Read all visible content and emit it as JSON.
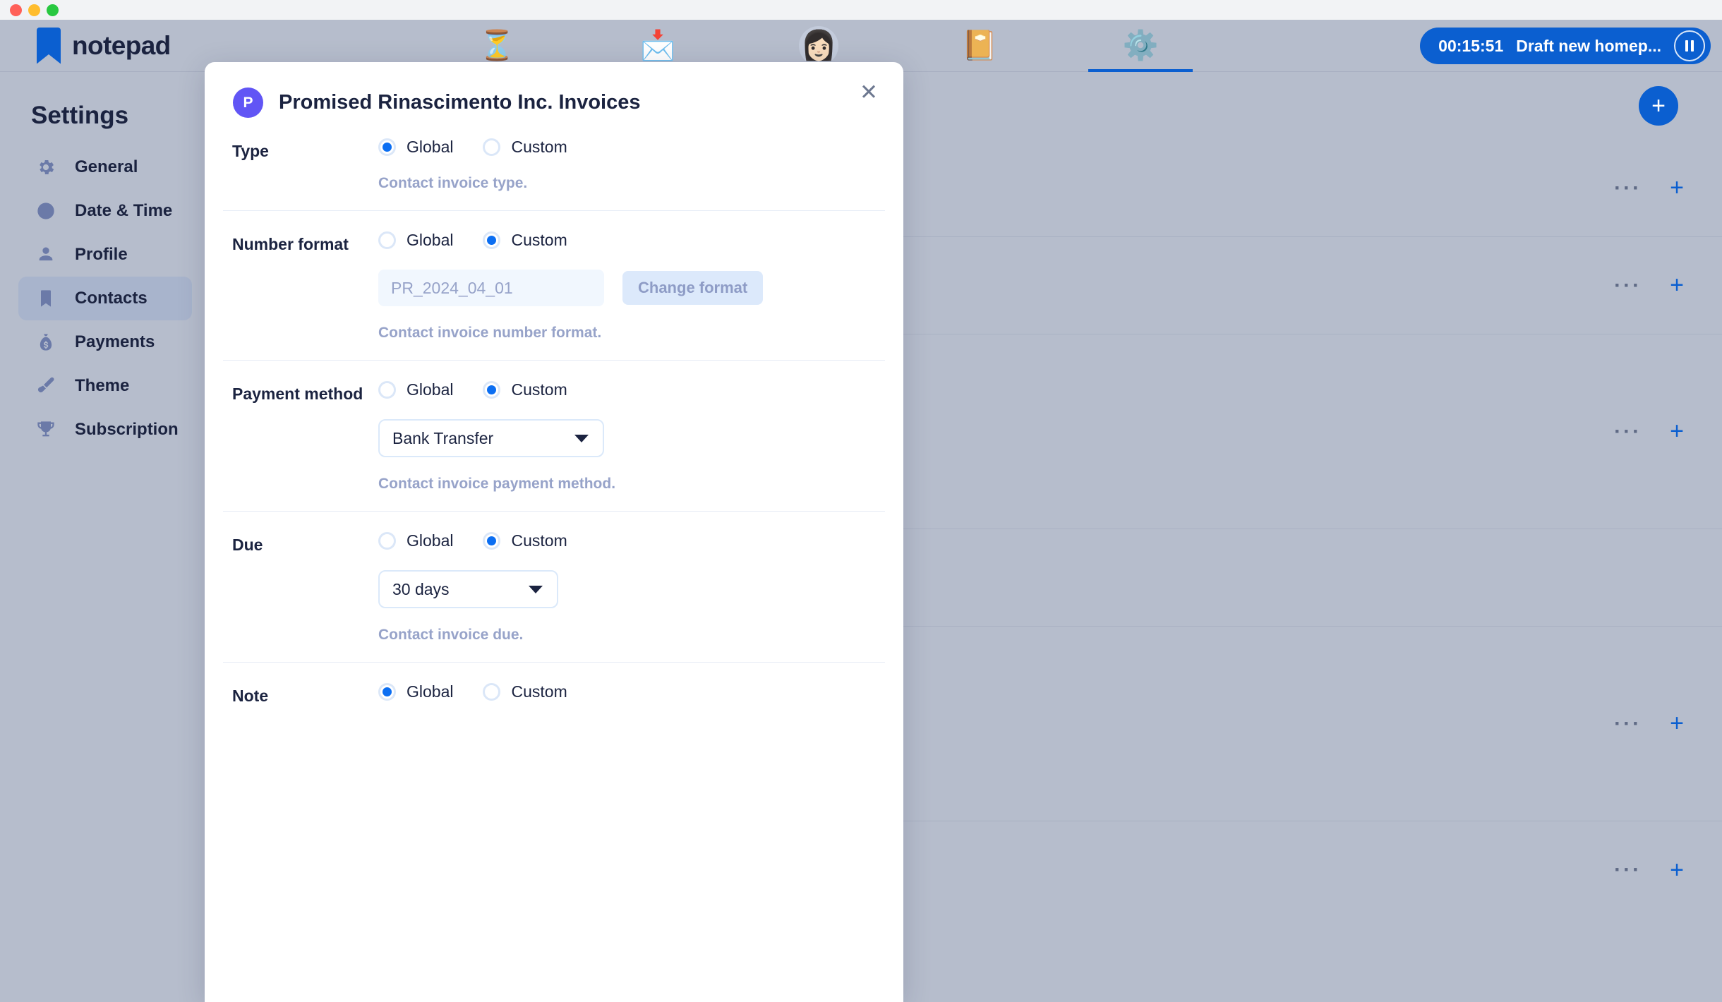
{
  "window": {
    "traffic_lights": [
      "close",
      "minimize",
      "maximize"
    ]
  },
  "topbar": {
    "brand": "notepad",
    "brand_logo_icon": "bookmark-icon",
    "nav": [
      {
        "name": "hourglass",
        "glyph": "⏳",
        "active": false
      },
      {
        "name": "envelope",
        "glyph": "📩",
        "active": false
      },
      {
        "name": "profile-avatar",
        "glyph": "👩🏻",
        "active": false
      },
      {
        "name": "notebook",
        "glyph": "📔",
        "active": false
      },
      {
        "name": "settings-gear",
        "glyph": "⚙️",
        "active": true
      }
    ],
    "timer": {
      "time": "00:15:51",
      "task": "Draft new homep...",
      "pause_icon": "pause-icon"
    }
  },
  "sidebar": {
    "title": "Settings",
    "items": [
      {
        "label": "General",
        "icon": "gear-icon",
        "active": false
      },
      {
        "label": "Date & Time",
        "icon": "clock-icon",
        "active": false
      },
      {
        "label": "Profile",
        "icon": "person-icon",
        "active": false
      },
      {
        "label": "Contacts",
        "icon": "bookmark-icon",
        "active": true
      },
      {
        "label": "Payments",
        "icon": "money-bag-icon",
        "active": false
      },
      {
        "label": "Theme",
        "icon": "paintbrush-icon",
        "active": false
      },
      {
        "label": "Subscription",
        "icon": "trophy-icon",
        "active": false
      }
    ]
  },
  "content_background": {
    "add_button_label": "+",
    "rows": [
      {
        "menu": "···",
        "add": "+"
      },
      {
        "menu": "···",
        "add": "+"
      },
      {
        "menu": "···",
        "add": "+"
      },
      {
        "menu": "···",
        "add": "+"
      },
      {
        "menu": "···",
        "add": "+"
      }
    ]
  },
  "modal": {
    "avatar_initial": "P",
    "title": "Promised Rinascimento Inc. Invoices",
    "close_icon": "close-icon",
    "close_label": "✕",
    "fields": [
      {
        "label": "Type",
        "options": [
          "Global",
          "Custom"
        ],
        "selected": "Global",
        "helper": "Contact invoice type."
      },
      {
        "label": "Number format",
        "options": [
          "Global",
          "Custom"
        ],
        "selected": "Custom",
        "input_value": "PR_2024_04_01",
        "button_label": "Change format",
        "helper": "Contact invoice number format."
      },
      {
        "label": "Payment method",
        "options": [
          "Global",
          "Custom"
        ],
        "selected": "Custom",
        "select_value": "Bank Transfer",
        "helper": "Contact invoice payment method."
      },
      {
        "label": "Due",
        "options": [
          "Global",
          "Custom"
        ],
        "selected": "Custom",
        "select_value": "30 days",
        "helper": "Contact invoice due."
      },
      {
        "label": "Note",
        "options": [
          "Global",
          "Custom"
        ],
        "selected": "Global",
        "helper": ""
      }
    ]
  }
}
